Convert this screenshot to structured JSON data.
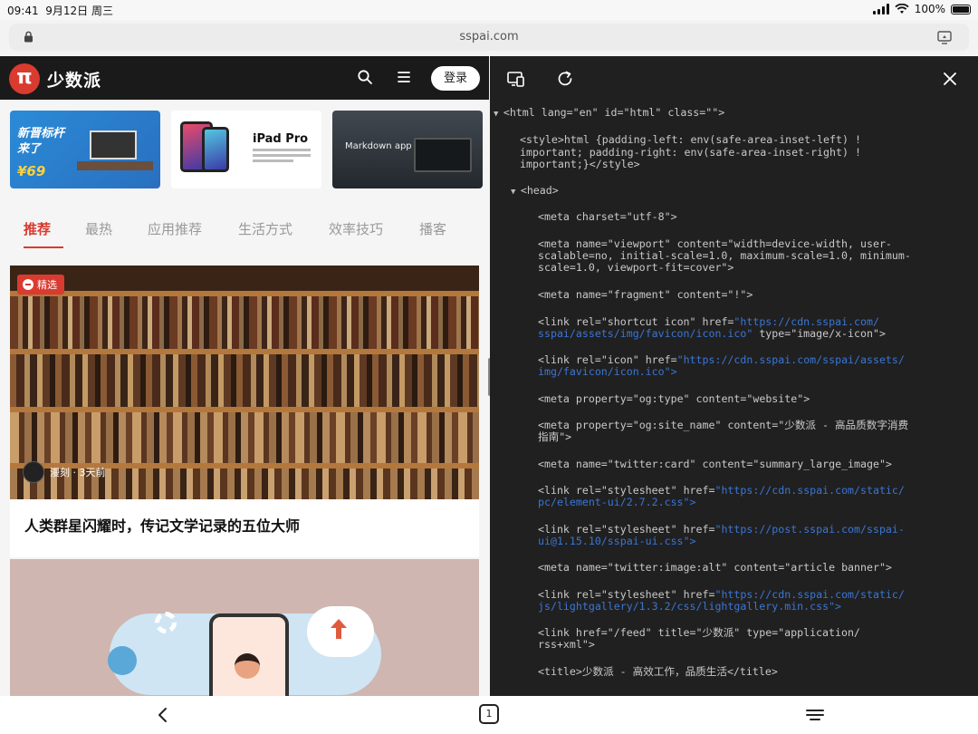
{
  "status_bar": {
    "time": "09:41",
    "date": "9月12日 周三",
    "battery": "100%"
  },
  "browser": {
    "url": "sspai.com"
  },
  "site": {
    "logo_glyph": "π",
    "name": "少数派",
    "login_label": "登录",
    "banners": [
      {
        "line1": "新晋标杆",
        "line2": "来了",
        "price": "¥69"
      },
      {
        "title": "iPad Pro"
      },
      {
        "title": "Markdown app"
      }
    ],
    "tabs": [
      "推荐",
      "最热",
      "应用推荐",
      "生活方式",
      "效率技巧",
      "播客"
    ],
    "featured_tag": "精选",
    "article": {
      "author": "漫刻  · 3天前",
      "title": "人类群星闪耀时，传记文学记录的五位大师"
    }
  },
  "devtools": {
    "lines": [
      {
        "indent": 0,
        "tri": "▼",
        "parts": [
          [
            "tg",
            "<html "
          ],
          [
            "an",
            "lang="
          ],
          [
            "av",
            "\"en\" "
          ],
          [
            "an",
            "id="
          ],
          [
            "av",
            "\"html\" "
          ],
          [
            "an",
            "class="
          ],
          [
            "av",
            "\"\">"
          ]
        ]
      },
      {
        "indent": 2,
        "parts": [
          [
            "tg",
            "<style>"
          ],
          [
            "av",
            "html {padding-left: env(safe-area-inset-left) !"
          ]
        ]
      },
      {
        "indent": 2,
        "parts": [
          [
            "av",
            "important; padding-right: env(safe-area-inset-right) !"
          ]
        ]
      },
      {
        "indent": 2,
        "parts": [
          [
            "av",
            "important;}"
          ],
          [
            "tg",
            "</style>"
          ]
        ]
      },
      {
        "indent": 1,
        "tri": "▼",
        "parts": [
          [
            "tg",
            "<head>"
          ]
        ]
      },
      {
        "indent": 4,
        "parts": [
          [
            "tg",
            "<meta "
          ],
          [
            "an",
            "charset="
          ],
          [
            "av",
            "\"utf-8\">"
          ]
        ]
      },
      {
        "indent": 4,
        "parts": [
          [
            "tg",
            "<meta "
          ],
          [
            "an",
            "name="
          ],
          [
            "av",
            "\"viewport\" "
          ],
          [
            "an",
            "content="
          ],
          [
            "av",
            "\"width=device-width, user-"
          ]
        ]
      },
      {
        "indent": 4,
        "parts": [
          [
            "av",
            "scalable=no, initial-scale=1.0, maximum-scale=1.0, minimum-"
          ]
        ]
      },
      {
        "indent": 4,
        "parts": [
          [
            "av",
            "scale=1.0, viewport-fit=cover\">"
          ]
        ]
      },
      {
        "indent": 4,
        "parts": [
          [
            "tg",
            "<meta "
          ],
          [
            "an",
            "name="
          ],
          [
            "av",
            "\"fragment\" "
          ],
          [
            "an",
            "content="
          ],
          [
            "av",
            "\"!\">"
          ]
        ]
      },
      {
        "indent": 4,
        "parts": [
          [
            "tg",
            "<link "
          ],
          [
            "an",
            "rel="
          ],
          [
            "av",
            "\"shortcut icon\" "
          ],
          [
            "an",
            "href="
          ],
          [
            "lnk",
            "\"https://cdn.sspai.com/"
          ]
        ]
      },
      {
        "indent": 4,
        "parts": [
          [
            "lnk",
            "sspai/assets/img/favicon/icon.ico\" "
          ],
          [
            "an",
            "type="
          ],
          [
            "av",
            "\"image/x-icon\">"
          ]
        ]
      },
      {
        "indent": 4,
        "parts": [
          [
            "tg",
            "<link "
          ],
          [
            "an",
            "rel="
          ],
          [
            "av",
            "\"icon\" "
          ],
          [
            "an",
            "href="
          ],
          [
            "lnk",
            "\"https://cdn.sspai.com/sspai/assets/"
          ]
        ]
      },
      {
        "indent": 4,
        "parts": [
          [
            "lnk",
            "img/favicon/icon.ico\">"
          ]
        ]
      },
      {
        "indent": 4,
        "parts": [
          [
            "tg",
            "<meta "
          ],
          [
            "an",
            "property="
          ],
          [
            "av",
            "\"og:type\" "
          ],
          [
            "an",
            "content="
          ],
          [
            "av",
            "\"website\">"
          ]
        ]
      },
      {
        "indent": 4,
        "parts": [
          [
            "tg",
            "<meta "
          ],
          [
            "an",
            "property="
          ],
          [
            "av",
            "\"og:site_name\" "
          ],
          [
            "an",
            "content="
          ],
          [
            "av",
            "\"少数派 - 高品质数字消费"
          ]
        ]
      },
      {
        "indent": 4,
        "parts": [
          [
            "av",
            "指南\">"
          ]
        ]
      },
      {
        "indent": 4,
        "parts": [
          [
            "tg",
            "<meta "
          ],
          [
            "an",
            "name="
          ],
          [
            "av",
            "\"twitter:card\" "
          ],
          [
            "an",
            "content="
          ],
          [
            "av",
            "\"summary_large_image\">"
          ]
        ]
      },
      {
        "indent": 4,
        "parts": [
          [
            "tg",
            "<link "
          ],
          [
            "an",
            "rel="
          ],
          [
            "av",
            "\"stylesheet\" "
          ],
          [
            "an",
            "href="
          ],
          [
            "lnk",
            "\"https://cdn.sspai.com/static/"
          ]
        ]
      },
      {
        "indent": 4,
        "parts": [
          [
            "lnk",
            "pc/element-ui/2.7.2.css\">"
          ]
        ]
      },
      {
        "indent": 4,
        "parts": [
          [
            "tg",
            "<link "
          ],
          [
            "an",
            "rel="
          ],
          [
            "av",
            "\"stylesheet\" "
          ],
          [
            "an",
            "href="
          ],
          [
            "lnk",
            "\"https://post.sspai.com/sspai-"
          ]
        ]
      },
      {
        "indent": 4,
        "parts": [
          [
            "lnk",
            "ui@1.15.10/sspai-ui.css\">"
          ]
        ]
      },
      {
        "indent": 4,
        "parts": [
          [
            "tg",
            "<meta "
          ],
          [
            "an",
            "name="
          ],
          [
            "av",
            "\"twitter:image:alt\" "
          ],
          [
            "an",
            "content="
          ],
          [
            "av",
            "\"article banner\">"
          ]
        ]
      },
      {
        "indent": 4,
        "parts": [
          [
            "tg",
            "<link "
          ],
          [
            "an",
            "rel="
          ],
          [
            "av",
            "\"stylesheet\" "
          ],
          [
            "an",
            "href="
          ],
          [
            "lnk",
            "\"https://cdn.sspai.com/static/"
          ]
        ]
      },
      {
        "indent": 4,
        "parts": [
          [
            "lnk",
            "js/lightgallery/1.3.2/css/lightgallery.min.css\">"
          ]
        ]
      },
      {
        "indent": 4,
        "parts": [
          [
            "tg",
            "<link "
          ],
          [
            "an",
            "href="
          ],
          [
            "av",
            "\"/feed\" "
          ],
          [
            "an",
            "title="
          ],
          [
            "av",
            "\"少数派\" "
          ],
          [
            "an",
            "type="
          ],
          [
            "av",
            "\"application/"
          ]
        ]
      },
      {
        "indent": 4,
        "parts": [
          [
            "av",
            "rss+xml\">"
          ]
        ]
      },
      {
        "indent": 4,
        "parts": [
          [
            "tg",
            "<title>"
          ],
          [
            "av",
            "少数派 - 高效工作，品质生活"
          ],
          [
            "tg",
            "</title>"
          ]
        ]
      }
    ]
  },
  "bottom_bar": {
    "tab_count": "1"
  }
}
